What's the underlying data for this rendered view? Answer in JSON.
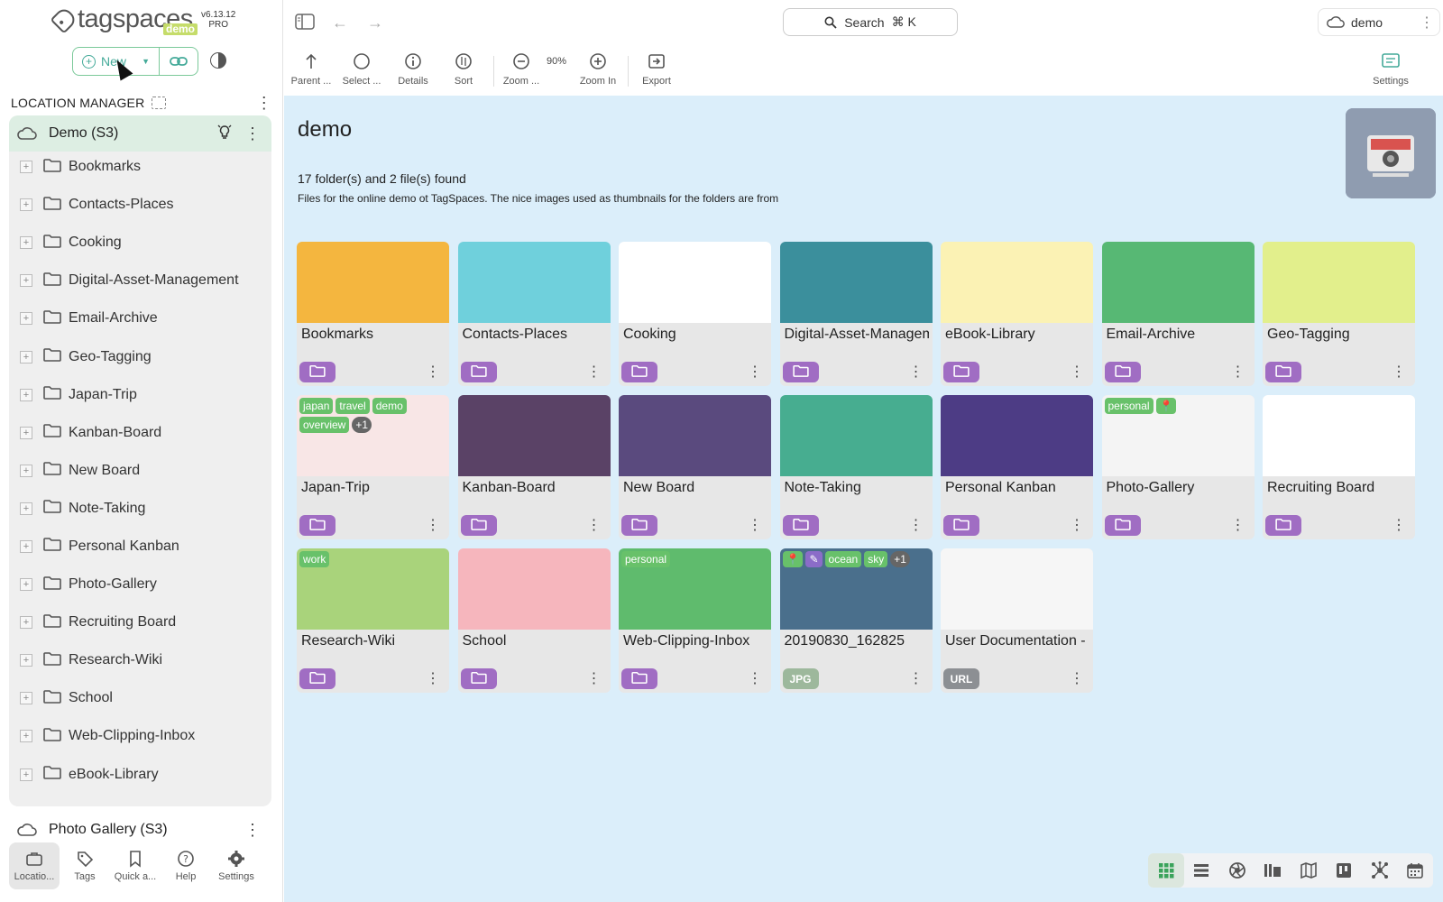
{
  "app": {
    "brand": "tagspaces",
    "demo_badge": "demo",
    "version": "v6.13.12",
    "edition": "PRO"
  },
  "sidebar": {
    "new_label": "New",
    "location_manager_label": "LOCATION MANAGER",
    "active_location": "Demo (S3)",
    "folders": [
      "Bookmarks",
      "Contacts-Places",
      "Cooking",
      "Digital-Asset-Management",
      "Email-Archive",
      "Geo-Tagging",
      "Japan-Trip",
      "Kanban-Board",
      "New Board",
      "Note-Taking",
      "Personal Kanban",
      "Photo-Gallery",
      "Recruiting Board",
      "Research-Wiki",
      "School",
      "Web-Clipping-Inbox",
      "eBook-Library"
    ],
    "other_location": "Photo Gallery (S3)",
    "nav": [
      {
        "label": "Locatio...",
        "icon": "briefcase-icon"
      },
      {
        "label": "Tags",
        "icon": "tag-icon"
      },
      {
        "label": "Quick a...",
        "icon": "bookmark-icon"
      },
      {
        "label": "Help",
        "icon": "help-icon"
      },
      {
        "label": "Settings",
        "icon": "gear-icon"
      }
    ]
  },
  "topbar": {
    "search_label": "Search",
    "search_shortcut": "⌘ K",
    "user_label": "demo"
  },
  "toolbar": {
    "parent": "Parent ...",
    "select": "Select ...",
    "details": "Details",
    "sort": "Sort",
    "zoom_out": "Zoom ...",
    "zoom_level": "90%",
    "zoom_in": "Zoom In",
    "export": "Export",
    "settings": "Settings"
  },
  "main": {
    "title": "demo",
    "summary": "17 folder(s) and 2 file(s) found",
    "description": "Files for the online demo ot TagSpaces. The nice images used as thumbnails for the folders are from",
    "cards": [
      {
        "name": "Bookmarks",
        "type": "folder",
        "bg": "#f4b63f",
        "tags": []
      },
      {
        "name": "Contacts-Places",
        "type": "folder",
        "bg": "#6fd0dc",
        "tags": []
      },
      {
        "name": "Cooking",
        "type": "folder",
        "bg": "#ffffff",
        "tags": []
      },
      {
        "name": "Digital-Asset-Management",
        "type": "folder",
        "bg": "#3b8f9c",
        "tags": []
      },
      {
        "name": "eBook-Library",
        "type": "folder",
        "bg": "#fbf2b4",
        "tags": []
      },
      {
        "name": "Email-Archive",
        "type": "folder",
        "bg": "#57b874",
        "tags": []
      },
      {
        "name": "Geo-Tagging",
        "type": "folder",
        "bg": "#e2ef8c",
        "tags": []
      },
      {
        "name": "Japan-Trip",
        "type": "folder",
        "bg": "#f8e6e6",
        "tags": [
          "japan",
          "travel",
          "demo",
          "overview",
          "+1"
        ]
      },
      {
        "name": "Kanban-Board",
        "type": "folder",
        "bg": "#5a4266",
        "tags": []
      },
      {
        "name": "New Board",
        "type": "folder",
        "bg": "#5a4a7e",
        "tags": []
      },
      {
        "name": "Note-Taking",
        "type": "folder",
        "bg": "#47ad90",
        "tags": []
      },
      {
        "name": "Personal Kanban",
        "type": "folder",
        "bg": "#4d3c85",
        "tags": []
      },
      {
        "name": "Photo-Gallery",
        "type": "folder",
        "bg": "#f4f4f4",
        "tags": [
          "personal",
          "📍"
        ]
      },
      {
        "name": "Recruiting Board",
        "type": "folder",
        "bg": "#ffffff",
        "tags": []
      },
      {
        "name": "Research-Wiki",
        "type": "folder",
        "bg": "#a9d37b",
        "tags": [
          "work"
        ]
      },
      {
        "name": "School",
        "type": "folder",
        "bg": "#f6b6bd",
        "tags": []
      },
      {
        "name": "Web-Clipping-Inbox",
        "type": "folder",
        "bg": "#5fbb6d",
        "tags": [
          "personal"
        ]
      },
      {
        "name": "20190830_162825",
        "type": "file",
        "ext": "JPG",
        "bg": "#4a6f8c",
        "tags": [
          "📍",
          "✎",
          "ocean",
          "sky",
          "+1"
        ]
      },
      {
        "name": "User Documentation -",
        "type": "file",
        "ext": "URL",
        "bg": "#f6f6f6",
        "tags": []
      }
    ]
  }
}
